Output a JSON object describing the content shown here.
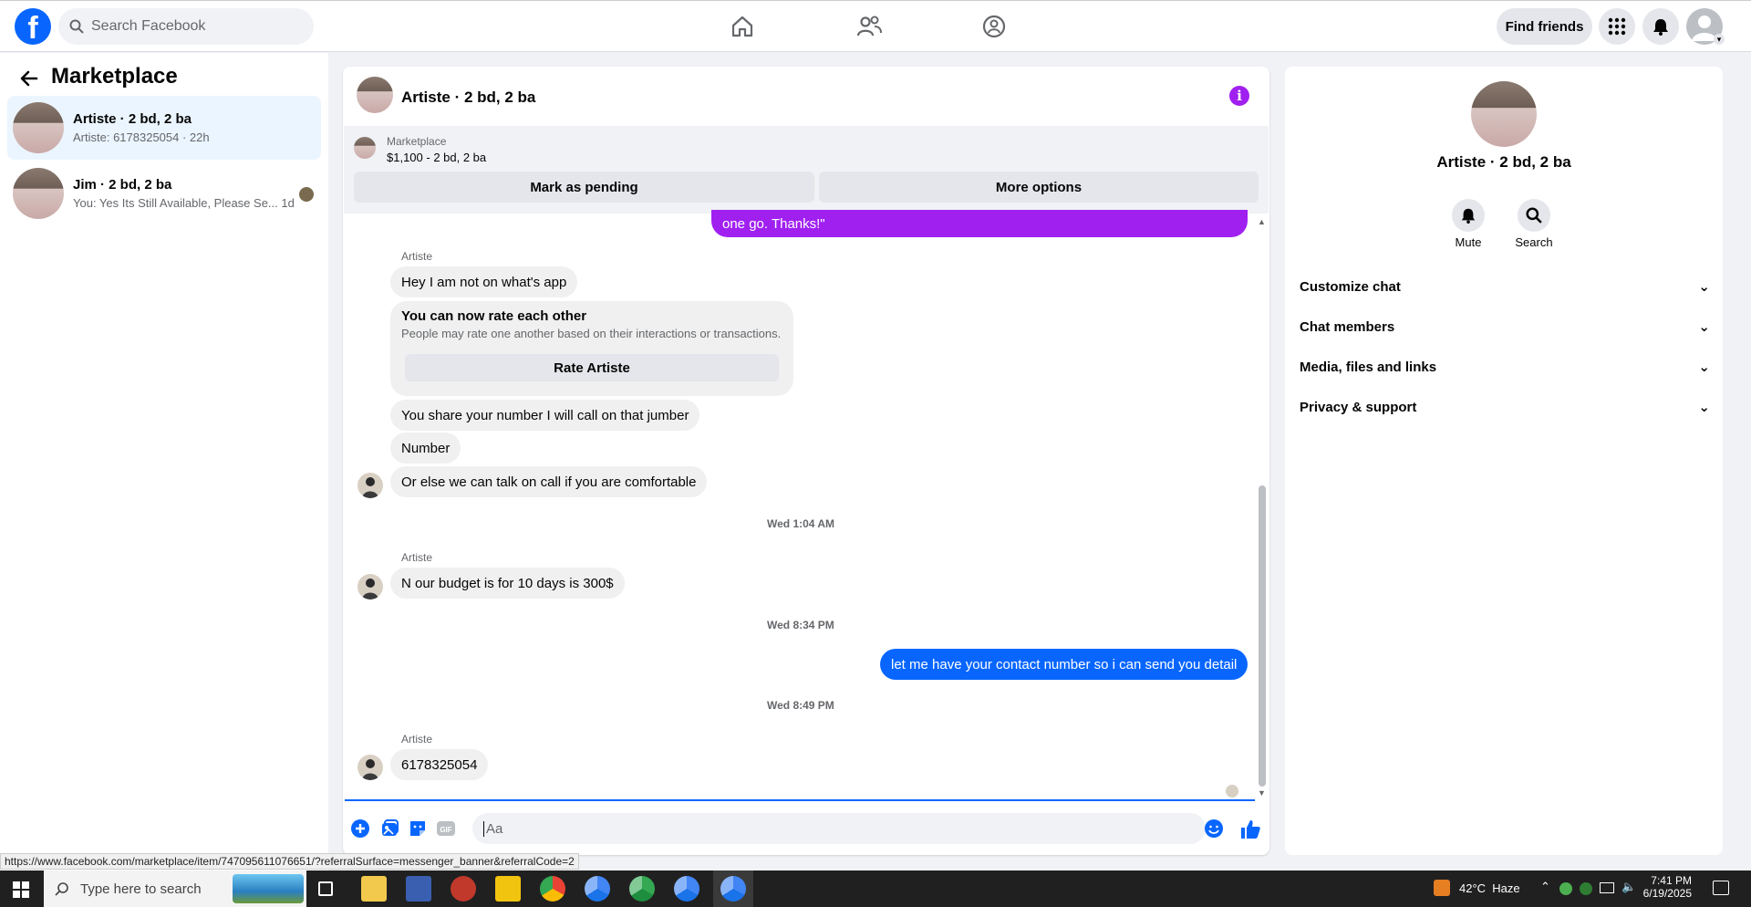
{
  "topbar": {
    "search_placeholder": "Search Facebook",
    "find_friends": "Find friends"
  },
  "left": {
    "title": "Marketplace",
    "conversations": [
      {
        "title": "Artiste · 2 bd, 2 ba",
        "subtitle": "Artiste: 6178325054 · 22h"
      },
      {
        "title": "Jim · 2 bd, 2 ba",
        "subtitle": "You: Yes Its Still Available, Please Se...",
        "time": "1d"
      }
    ]
  },
  "chat": {
    "header_title": "Artiste · 2 bd, 2 ba",
    "banner_label": "Marketplace",
    "banner_price": "$1,100 - 2 bd, 2 ba",
    "mark_pending": "Mark as pending",
    "more_options": "More options",
    "top_partial_message": "one go. Thanks!\"",
    "sender_name": "Artiste",
    "messages": {
      "m1": "Hey I am not on what's app",
      "rate_title": "You can now rate each other",
      "rate_desc": "People may rate one another based on their interactions or transactions.",
      "rate_button": "Rate Artiste",
      "m2": "You share your number I will call on that jumber",
      "m3": "Number",
      "m4": "Or else we can talk on call if you are comfortable",
      "ts1": "Wed 1:04 AM",
      "m5": "N our budget is for 10 days is 300$",
      "ts2": "Wed 8:34 PM",
      "m6": "let me have your contact number so i can send you detail",
      "ts3": "Wed 8:49 PM",
      "m7": "6178325054"
    },
    "composer_placeholder": "Aa"
  },
  "right": {
    "name": "Artiste · 2 bd, 2 ba",
    "mute": "Mute",
    "search": "Search",
    "sections": [
      "Customize chat",
      "Chat members",
      "Media, files and links",
      "Privacy & support"
    ]
  },
  "status_url": "https://www.facebook.com/marketplace/item/747095611076651/?referralSurface=messenger_banner&referralCode=2",
  "taskbar": {
    "search_placeholder": "Type here to search",
    "weather": "42°C  Haze",
    "time": "7:41 PM",
    "date": "6/19/2025"
  },
  "colors": {
    "accent": "#0866ff",
    "purple": "#a020f0"
  }
}
